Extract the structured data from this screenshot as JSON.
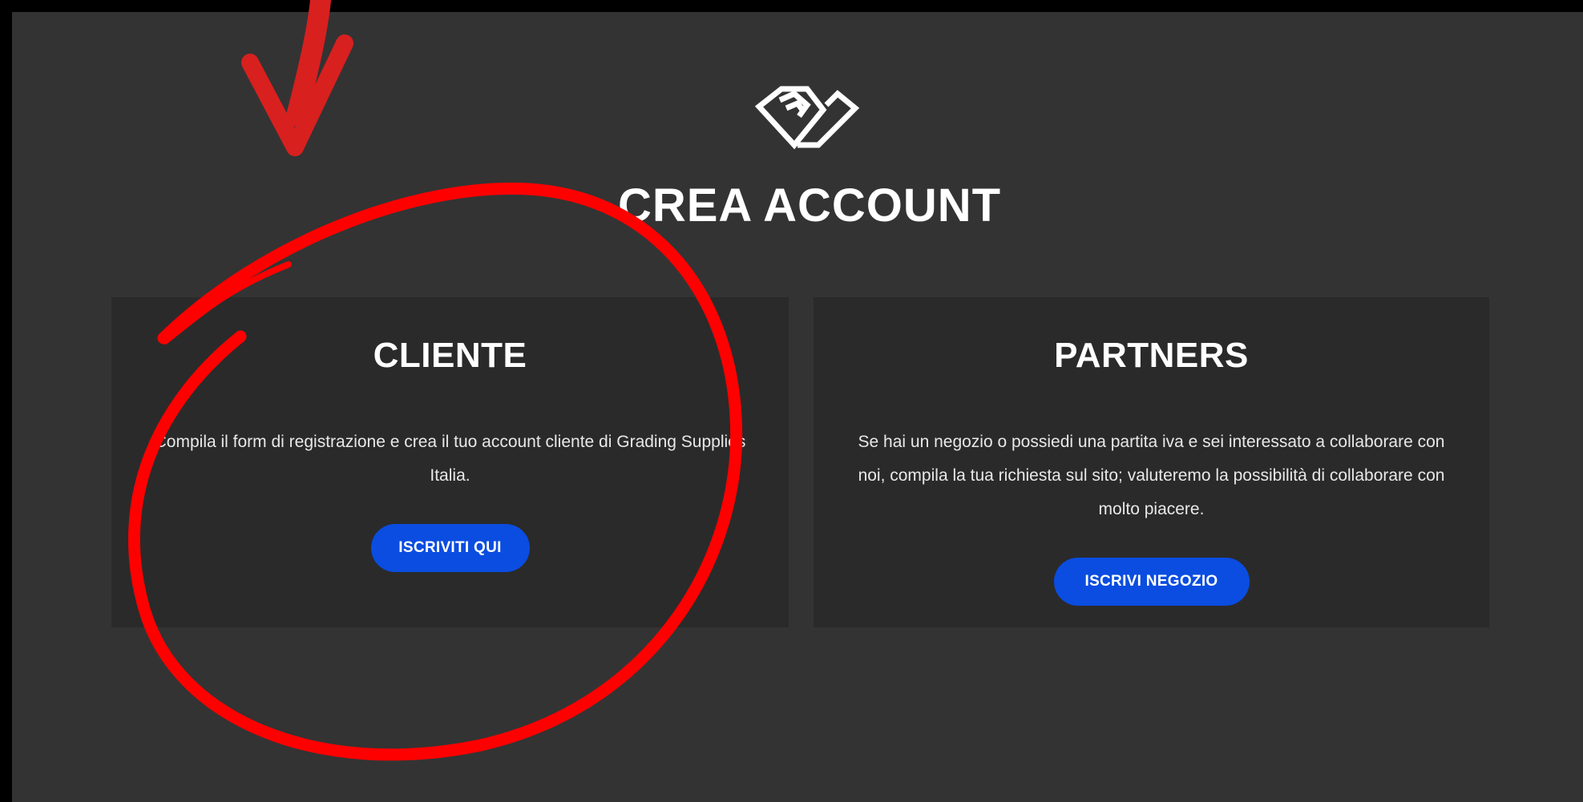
{
  "header": {
    "logo_icon": "diamond-logo-icon",
    "title": "CREA ACCOUNT"
  },
  "cards": {
    "cliente": {
      "title": "CLIENTE",
      "text": "Compila il form di registrazione e crea il tuo account cliente di Grading Supplies Italia.",
      "button_label": "ISCRIVITI QUI"
    },
    "partners": {
      "title": "PARTNERS",
      "text": "Se hai un negozio o possiedi una partita iva e sei interessato a collaborare con noi, compila la tua richiesta sul sito; valuteremo la possibilità di collaborare con molto piacere.",
      "button_label": "ISCRIVI NEGOZIO"
    }
  },
  "annotation": {
    "arrow_icon": "red-arrow-icon",
    "circle_icon": "red-circle-highlight-icon"
  },
  "colors": {
    "background": "#333333",
    "card": "#2a2a2a",
    "button": "#0a4de0",
    "annotation": "#ff0000"
  }
}
